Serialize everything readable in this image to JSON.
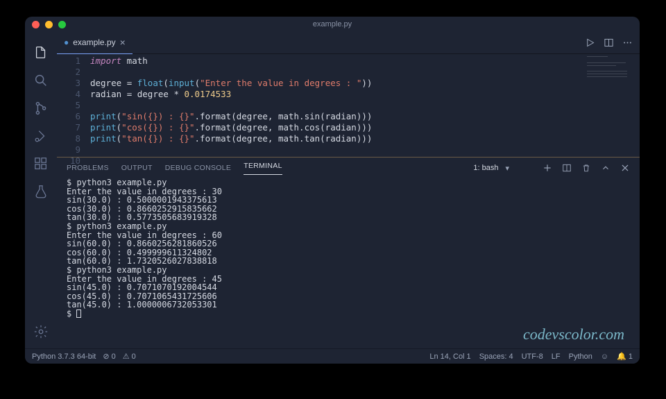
{
  "window": {
    "title": "example.py"
  },
  "tab": {
    "icon": "●",
    "label": "example.py"
  },
  "gutter": [
    "1",
    "2",
    "3",
    "4",
    "5",
    "6",
    "7",
    "8",
    "9",
    "10"
  ],
  "code": {
    "l1_kw": "import",
    "l1_mod": " math",
    "l3_a": "degree ",
    "l3_eq": "=",
    "l3_b": " ",
    "l3_float": "float",
    "l3_p1": "(",
    "l3_input": "input",
    "l3_p2": "(",
    "l3_str": "\"Enter the value in degrees : \"",
    "l3_p3": "))",
    "l4_a": "radian ",
    "l4_eq": "=",
    "l4_b": " degree ",
    "l4_op": "*",
    "l4_sp": " ",
    "l4_num": "0.0174533",
    "l6_p": "print",
    "l6_p1": "(",
    "l6_str": "\"sin({}) : {}\"",
    "l6_fmt": ".format(degree, math.sin(radian)))",
    "l7_p": "print",
    "l7_p1": "(",
    "l7_str": "\"cos({}) : {}\"",
    "l7_fmt": ".format(degree, math.cos(radian)))",
    "l8_p": "print",
    "l8_p1": "(",
    "l8_str": "\"tan({}) : {}\"",
    "l8_fmt": ".format(degree, math.tan(radian)))"
  },
  "panel_tabs": {
    "problems": "PROBLEMS",
    "output": "OUTPUT",
    "debug": "DEBUG CONSOLE",
    "terminal": "TERMINAL"
  },
  "terminal_selector": "1: bash",
  "terminal_lines": [
    "$ python3 example.py",
    "Enter the value in degrees : 30",
    "sin(30.0) : 0.5000001943375613",
    "cos(30.0) : 0.8660252915835662",
    "tan(30.0) : 0.5773505683919328",
    "$ python3 example.py",
    "Enter the value in degrees : 60",
    "sin(60.0) : 0.8660256281860526",
    "cos(60.0) : 0.499999611324802",
    "tan(60.0) : 1.7320526027838818",
    "$ python3 example.py",
    "Enter the value in degrees : 45",
    "sin(45.0) : 0.7071070192004544",
    "cos(45.0) : 0.7071065431725606",
    "tan(45.0) : 1.0000006732053301",
    "$ "
  ],
  "status": {
    "python": "Python 3.7.3 64-bit",
    "errors": "⊘ 0",
    "warnings": "⚠ 0",
    "lncol": "Ln 14, Col 1",
    "spaces": "Spaces: 4",
    "encoding": "UTF-8",
    "eol": "LF",
    "lang": "Python",
    "bell": "1"
  },
  "watermark": "codevscolor.com"
}
